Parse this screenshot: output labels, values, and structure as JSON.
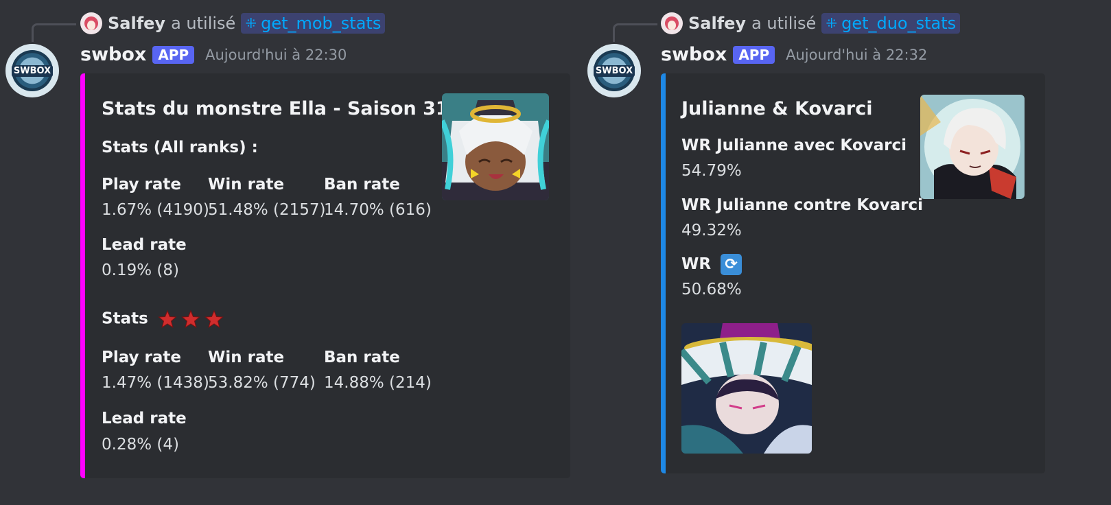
{
  "messages": [
    {
      "reply": {
        "user": "Salfey",
        "verb": "a utilisé",
        "command": "get_mob_stats"
      },
      "bot_name": "swbox",
      "bot_tag": "APP",
      "avatar_text": "SWBOX",
      "timestamp": "Aujourd'hui à 22:30",
      "embed": {
        "accent": "#ff00ff",
        "title": "Stats du monstre Ella - Saison 31",
        "section1": "Stats (All ranks) :",
        "s1_fields": [
          {
            "name": "Play rate",
            "value": "1.67% (4190)"
          },
          {
            "name": "Win rate",
            "value": "51.48% (2157)"
          },
          {
            "name": "Ban rate",
            "value": "14.70% (616)"
          },
          {
            "name": "Lead rate",
            "value": "0.19% (8)"
          }
        ],
        "section2": "Stats",
        "s2_fields": [
          {
            "name": "Play rate",
            "value": "1.47% (1438)"
          },
          {
            "name": "Win rate",
            "value": "53.82% (774)"
          },
          {
            "name": "Ban rate",
            "value": "14.88% (214)"
          },
          {
            "name": "Lead rate",
            "value": "0.28% (4)"
          }
        ]
      }
    },
    {
      "reply": {
        "user": "Salfey",
        "verb": "a utilisé",
        "command": "get_duo_stats"
      },
      "bot_name": "swbox",
      "bot_tag": "APP",
      "avatar_text": "SWBOX",
      "timestamp": "Aujourd'hui à 22:32",
      "embed": {
        "accent": "#1e88e5",
        "title": "Julianne & Kovarci",
        "fields": [
          {
            "name": "WR Julianne avec Kovarci",
            "value": "54.79%"
          },
          {
            "name": "WR Julianne contre Kovarci",
            "value": "49.32%"
          },
          {
            "name": "WR",
            "value": "50.68%"
          }
        ]
      }
    }
  ],
  "colors": {
    "background": "#313338",
    "embed_bg": "#2b2d31",
    "app_tag": "#5865f2",
    "command_link": "#00a8fc"
  }
}
